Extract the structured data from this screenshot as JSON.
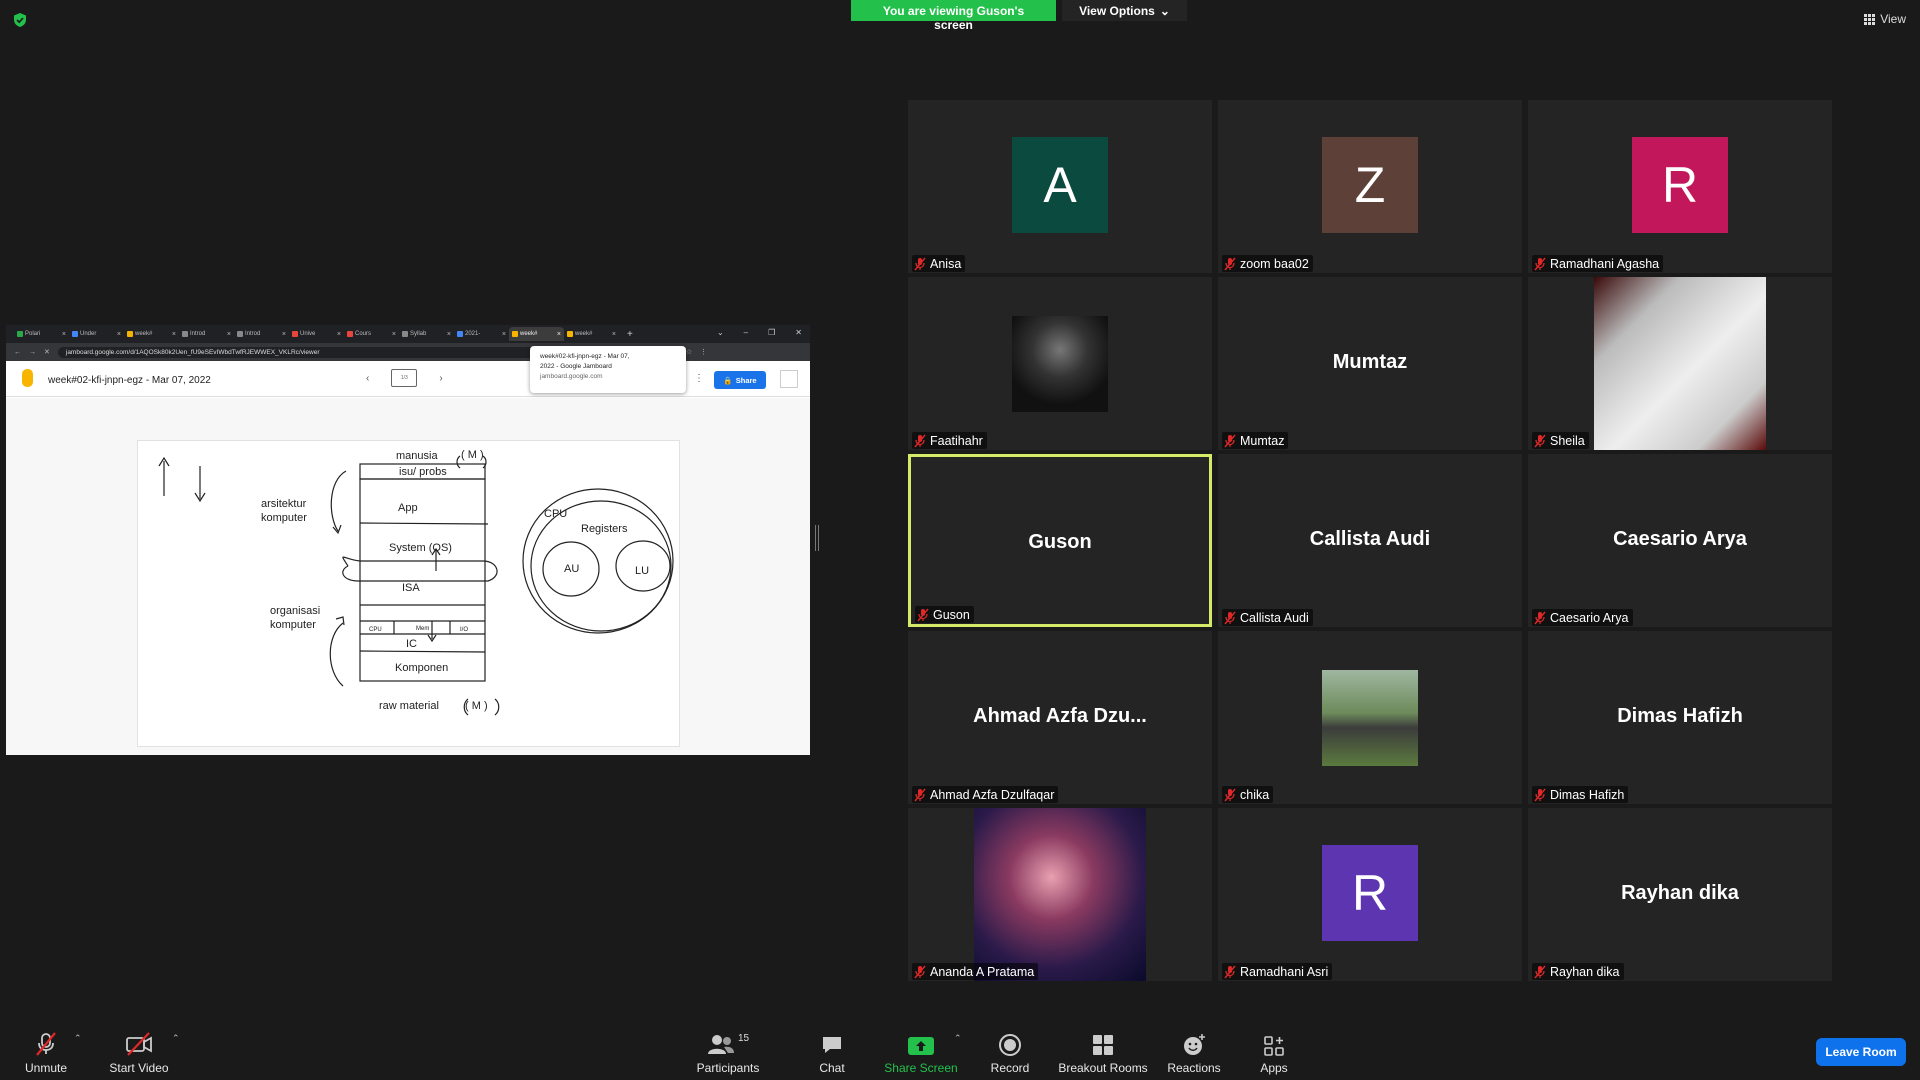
{
  "banner": {
    "viewing_text": "You are viewing Guson's screen",
    "view_options_label": "View Options"
  },
  "top_right": {
    "view_label": "View"
  },
  "shared_screen": {
    "tabs": [
      {
        "label": "Polari"
      },
      {
        "label": "Under"
      },
      {
        "label": "week#"
      },
      {
        "label": "Introd"
      },
      {
        "label": "Introd"
      },
      {
        "label": "Unive"
      },
      {
        "label": "Cours"
      },
      {
        "label": "Syllab"
      },
      {
        "label": "2021-"
      },
      {
        "label": "week#"
      },
      {
        "label": "week#"
      }
    ],
    "url": "jamboard.google.com/d/1AQOSk80k2Uen_fU9eSEvIWbdTwfRJEWWEX_VKLRc/viewer",
    "tooltip": {
      "line1": "week#02-kfi-jnpn-egz - Mar 07,",
      "line2": "2022 - Google Jamboard",
      "line3": "jamboard.google.com"
    },
    "jamboard_title": "week#02-kfi-jnpn-egz - Mar 07, 2022",
    "frame_indicator": "1/3",
    "share_label": "Share",
    "whiteboard_texts": {
      "manusia": "manusia",
      "m_top": "( M )",
      "isu": "isu/ probs",
      "arsitektur": "arsitektur",
      "komputer1": "komputer",
      "app": "App",
      "system": "System (OS)",
      "isa": "ISA",
      "organisasi": "organisasi",
      "komputer2": "komputer",
      "cpu_small": "CPU",
      "mem_small": "Mem",
      "io_small": "I/O",
      "ic": "IC",
      "komponen": "Komponen",
      "raw": "raw material",
      "m_bottom": "( M )",
      "cpu": "CPU",
      "registers": "Registers",
      "au": "AU",
      "lu": "LU"
    }
  },
  "participants": [
    {
      "name": "Anisa",
      "initial": "A",
      "color": "#0b4a3f",
      "type": "initial"
    },
    {
      "name": "zoom baa02",
      "initial": "Z",
      "color": "#5d4037",
      "type": "initial"
    },
    {
      "name": "Ramadhani Agasha",
      "initial": "R",
      "color": "#c2185b",
      "type": "initial"
    },
    {
      "name": "Faatihahr",
      "type": "photo"
    },
    {
      "name": "Mumtaz",
      "display": "Mumtaz",
      "type": "name"
    },
    {
      "name": "Sheila",
      "type": "photo"
    },
    {
      "name": "Guson",
      "display": "Guson",
      "type": "name",
      "active": true
    },
    {
      "name": "Callista Audi",
      "display": "Callista Audi",
      "type": "name"
    },
    {
      "name": "Caesario Arya",
      "display": "Caesario Arya",
      "type": "name"
    },
    {
      "name": "Ahmad Azfa Dzulfaqar",
      "display": "Ahmad  Azfa  Dzu...",
      "type": "name"
    },
    {
      "name": "chika",
      "type": "photo"
    },
    {
      "name": "Dimas Hafizh",
      "display": "Dimas Hafizh",
      "type": "name"
    },
    {
      "name": "Ananda A Pratama",
      "type": "photo"
    },
    {
      "name": "Ramadhani Asri",
      "initial": "R",
      "color": "#5e35b1",
      "type": "initial"
    },
    {
      "name": "Rayhan dika",
      "display": "Rayhan dika",
      "type": "name"
    }
  ],
  "toolbar": {
    "unmute": "Unmute",
    "start_video": "Start Video",
    "participants": "Participants",
    "participants_count": "15",
    "chat": "Chat",
    "share_screen": "Share Screen",
    "record": "Record",
    "breakout_rooms": "Breakout Rooms",
    "reactions": "Reactions",
    "apps": "Apps",
    "leave_room": "Leave Room"
  },
  "colors": {
    "share_green": "#23c14b",
    "active_border": "#d6ea6a",
    "leave_blue": "#0e72ed",
    "mic_red": "#e02828"
  }
}
